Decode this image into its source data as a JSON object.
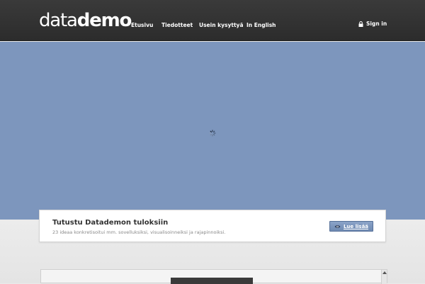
{
  "header": {
    "logo_light": "data",
    "logo_bold": "demo",
    "nav": [
      {
        "label": "Etusivu"
      },
      {
        "label": "Tiedotteet"
      },
      {
        "label": "Usein kysyttyä"
      },
      {
        "label": "In English"
      }
    ],
    "signin_label": "Sign in"
  },
  "promo": {
    "title": "Tutustu Datademon tuloksiin",
    "subtitle": "23 ideaa konkretisoitui mm. sovelluksiksi, visualisoinneiksi ja rajapinnoiksi.",
    "button_label": "Lue lisää"
  },
  "colors": {
    "topbar": "#2f2f2f",
    "hero": "#7d96bd",
    "button": "#7e98c0"
  },
  "icons": {
    "lock": "lock-icon",
    "eye": "eye-icon",
    "spinner": "loading-spinner-icon"
  }
}
